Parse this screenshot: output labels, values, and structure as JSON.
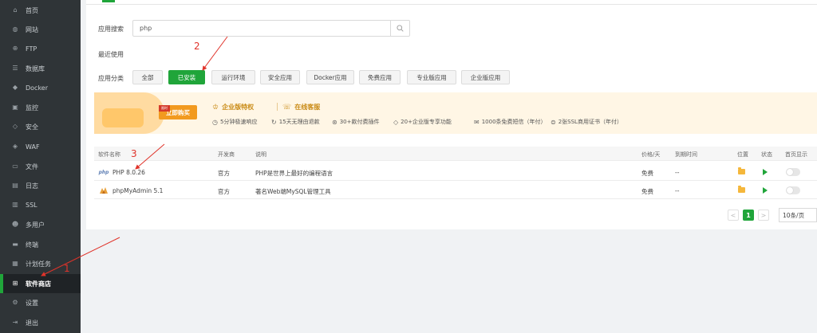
{
  "sidebar": {
    "items": [
      {
        "label": "首页",
        "icon": "home-icon"
      },
      {
        "label": "网站",
        "icon": "globe-icon"
      },
      {
        "label": "FTP",
        "icon": "ftp-icon"
      },
      {
        "label": "数据库",
        "icon": "database-icon"
      },
      {
        "label": "Docker",
        "icon": "docker-icon"
      },
      {
        "label": "监控",
        "icon": "monitor-icon"
      },
      {
        "label": "安全",
        "icon": "shield-icon"
      },
      {
        "label": "WAF",
        "icon": "waf-shield-icon"
      },
      {
        "label": "文件",
        "icon": "folder-icon"
      },
      {
        "label": "日志",
        "icon": "log-icon"
      },
      {
        "label": "SSL",
        "icon": "ssl-icon"
      },
      {
        "label": "多用户",
        "icon": "users-icon"
      },
      {
        "label": "终端",
        "icon": "terminal-icon"
      },
      {
        "label": "计划任务",
        "icon": "calendar-icon"
      },
      {
        "label": "软件商店",
        "icon": "grid-icon",
        "active": true
      },
      {
        "label": "设置",
        "icon": "gear-icon"
      },
      {
        "label": "退出",
        "icon": "logout-icon"
      }
    ]
  },
  "search": {
    "label": "应用搜索",
    "value": "php"
  },
  "recent": {
    "label": "最近使用"
  },
  "categories": {
    "label": "应用分类",
    "items": [
      "全部",
      "已安装",
      "运行环境",
      "安全应用",
      "Docker应用",
      "免费应用",
      "专业版应用",
      "企业版应用"
    ],
    "active": "已安装"
  },
  "banner": {
    "buy_label": "立即购买",
    "ribbon_label": "限时",
    "privilege_label": "企业版特权",
    "service_label": "在线客服",
    "features": [
      "5分钟极速响应",
      "15天无理由退款",
      "30+款付费插件",
      "20+企业版专享功能",
      "1000条免费短信（年付）",
      "2张SSL商用证书（年付）"
    ]
  },
  "table": {
    "headers": {
      "name": "软件名称",
      "developer": "开发商",
      "description": "说明",
      "price": "价格/天",
      "expire": "到期时间",
      "location": "位置",
      "status": "状态",
      "homepage": "首页显示"
    },
    "rows": [
      {
        "name": "PHP 8.0.26",
        "icon_text": "php",
        "developer": "官方",
        "description": "PHP是世界上最好的编程语言",
        "price": "免费",
        "expire": "--"
      },
      {
        "name": "phpMyAdmin 5.1",
        "icon_text": "",
        "developer": "官方",
        "description": "著名Web端MySQL管理工具",
        "price": "免费",
        "expire": "--"
      }
    ]
  },
  "pagination": {
    "prev": "<",
    "current": "1",
    "next": ">",
    "page_size": "10条/页"
  },
  "annotations": {
    "one": "1",
    "two": "2",
    "three": "3"
  },
  "colors": {
    "accent": "#20a53a",
    "sidebar_bg": "#2f3437",
    "annotation": "#e0332a",
    "banner_gold": "#c98a14"
  }
}
